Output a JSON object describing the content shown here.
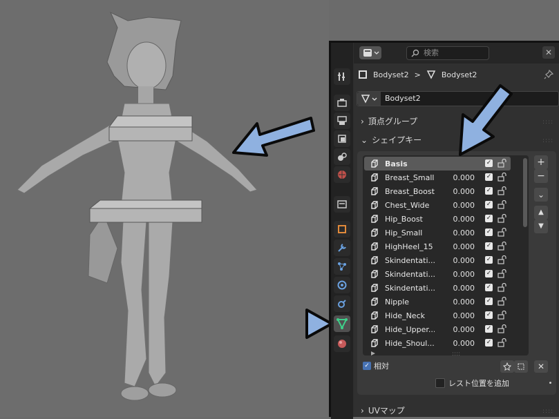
{
  "header": {
    "search_placeholder": "検索",
    "close_glyph": "✕"
  },
  "breadcrumb": {
    "object_name": "Bodyset2",
    "separator": ">",
    "mesh_name": "Bodyset2"
  },
  "datablock": {
    "name": "Bodyset2"
  },
  "sections": {
    "vertex_groups": "頂点グループ",
    "shape_keys": "シェイプキー",
    "uv_maps": "UVマップ"
  },
  "shape_keys": [
    {
      "name": "Basis",
      "value": "",
      "selected": true
    },
    {
      "name": "Breast_Small",
      "value": "0.000"
    },
    {
      "name": "Breast_Boost",
      "value": "0.000"
    },
    {
      "name": "Chest_Wide",
      "value": "0.000"
    },
    {
      "name": "Hip_Boost",
      "value": "0.000"
    },
    {
      "name": "Hip_Small",
      "value": "0.000"
    },
    {
      "name": "HighHeel_15",
      "value": "0.000"
    },
    {
      "name": "Skindentati...",
      "value": "0.000"
    },
    {
      "name": "Skindentati...",
      "value": "0.000"
    },
    {
      "name": "Skindentati...",
      "value": "0.000"
    },
    {
      "name": "Nipple",
      "value": "0.000"
    },
    {
      "name": "Hide_Neck",
      "value": "0.000"
    },
    {
      "name": "Hide_Upper...",
      "value": "0.000"
    },
    {
      "name": "Hide_Shoul...",
      "value": "0.000"
    }
  ],
  "list_buttons": {
    "add": "+",
    "remove": "−",
    "menu": "⌄",
    "move_up": "▲",
    "move_down": "▼"
  },
  "options": {
    "relative_label": "相対",
    "relative_checked": true,
    "rest_position_label": "レスト位置を追加",
    "rest_position_checked": false
  },
  "colors": {
    "arrow_fill": "#8fb1e0",
    "arrow_stroke": "#0a0a0a",
    "mesh_icon_green": "#3fcf8a",
    "accent_blue": "#4772b3"
  },
  "icons": {
    "tabs": [
      "tool-icon",
      "render-icon",
      "output-icon",
      "view-layer-icon",
      "scene-icon",
      "world-icon",
      "collection-icon",
      "object-icon",
      "modifier-icon",
      "particles-icon",
      "physics-icon",
      "constraints-icon",
      "object-data-icon",
      "material-icon"
    ]
  }
}
